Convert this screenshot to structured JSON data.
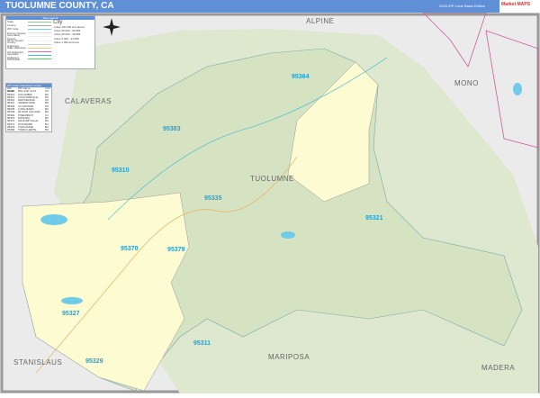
{
  "header": {
    "title": "TUOLUMNE COUNTY, CA",
    "edition": "2023 ZIP Code Basic Edition",
    "logo_text": "Market MAPS"
  },
  "legend": {
    "title": "Map Legend",
    "items": [
      "State",
      "County",
      "ZIP Code",
      "Primary Streets",
      "Secondary Streets",
      "Minor Streets",
      "County Highways",
      "State Highways",
      "US Highways",
      "Interstate Highways",
      "Toll Roads"
    ],
    "city_title": "City",
    "city_sizes": [
      "Cities 100,000 and above",
      "Cities 50,000 - 99,999",
      "Cities 25,000 - 49,999",
      "Cities 5,000 - 24,999",
      "Cities 1,000 and less"
    ]
  },
  "zip_index": {
    "title": "ZIP Code Index/Grid Locator",
    "headers": [
      "ZIP Code",
      "ZIP Name",
      "LOC"
    ],
    "rows": [
      [
        "95305",
        "BIG OAK FLAT",
        "C6"
      ],
      [
        "95310",
        "COLUMBIA",
        "B4"
      ],
      [
        "95311",
        "COULTERVILLE",
        "D6"
      ],
      [
        "95321",
        "GROVELAND",
        "C6"
      ],
      [
        "95327",
        "JAMESTOWN",
        "B5"
      ],
      [
        "95329",
        "LA GRANGE",
        "D5"
      ],
      [
        "95335",
        "LONG BARN",
        "B3"
      ],
      [
        "95346",
        "MI WUK VILLAGE",
        "B3"
      ],
      [
        "95364",
        "PINECREST",
        "C2"
      ],
      [
        "95370",
        "SONORA",
        "B4"
      ],
      [
        "95372",
        "SOULSBYVILLE",
        "B4"
      ],
      [
        "95373",
        "STANDARD",
        "B4"
      ],
      [
        "95379",
        "TUOLUMNE",
        "B4"
      ],
      [
        "95383",
        "TWAIN HARTE",
        "B3"
      ]
    ]
  },
  "counties": [
    {
      "name": "ALPINE"
    },
    {
      "name": "CALAVERAS"
    },
    {
      "name": "MONO"
    },
    {
      "name": "TUOLUMNE"
    },
    {
      "name": "MARIPOSA"
    },
    {
      "name": "STANISLAUS"
    },
    {
      "name": "MADERA"
    }
  ],
  "zips": [
    "95364",
    "95383",
    "95310",
    "95335",
    "95321",
    "95370",
    "95379",
    "95327",
    "95311",
    "95329"
  ],
  "colors": {
    "header": "#5f8fd6",
    "forest": "#d5e3c3",
    "county_fill": "#fdfbd2",
    "outside": "#ebebeb",
    "zip_label": "#1ea3d9"
  }
}
